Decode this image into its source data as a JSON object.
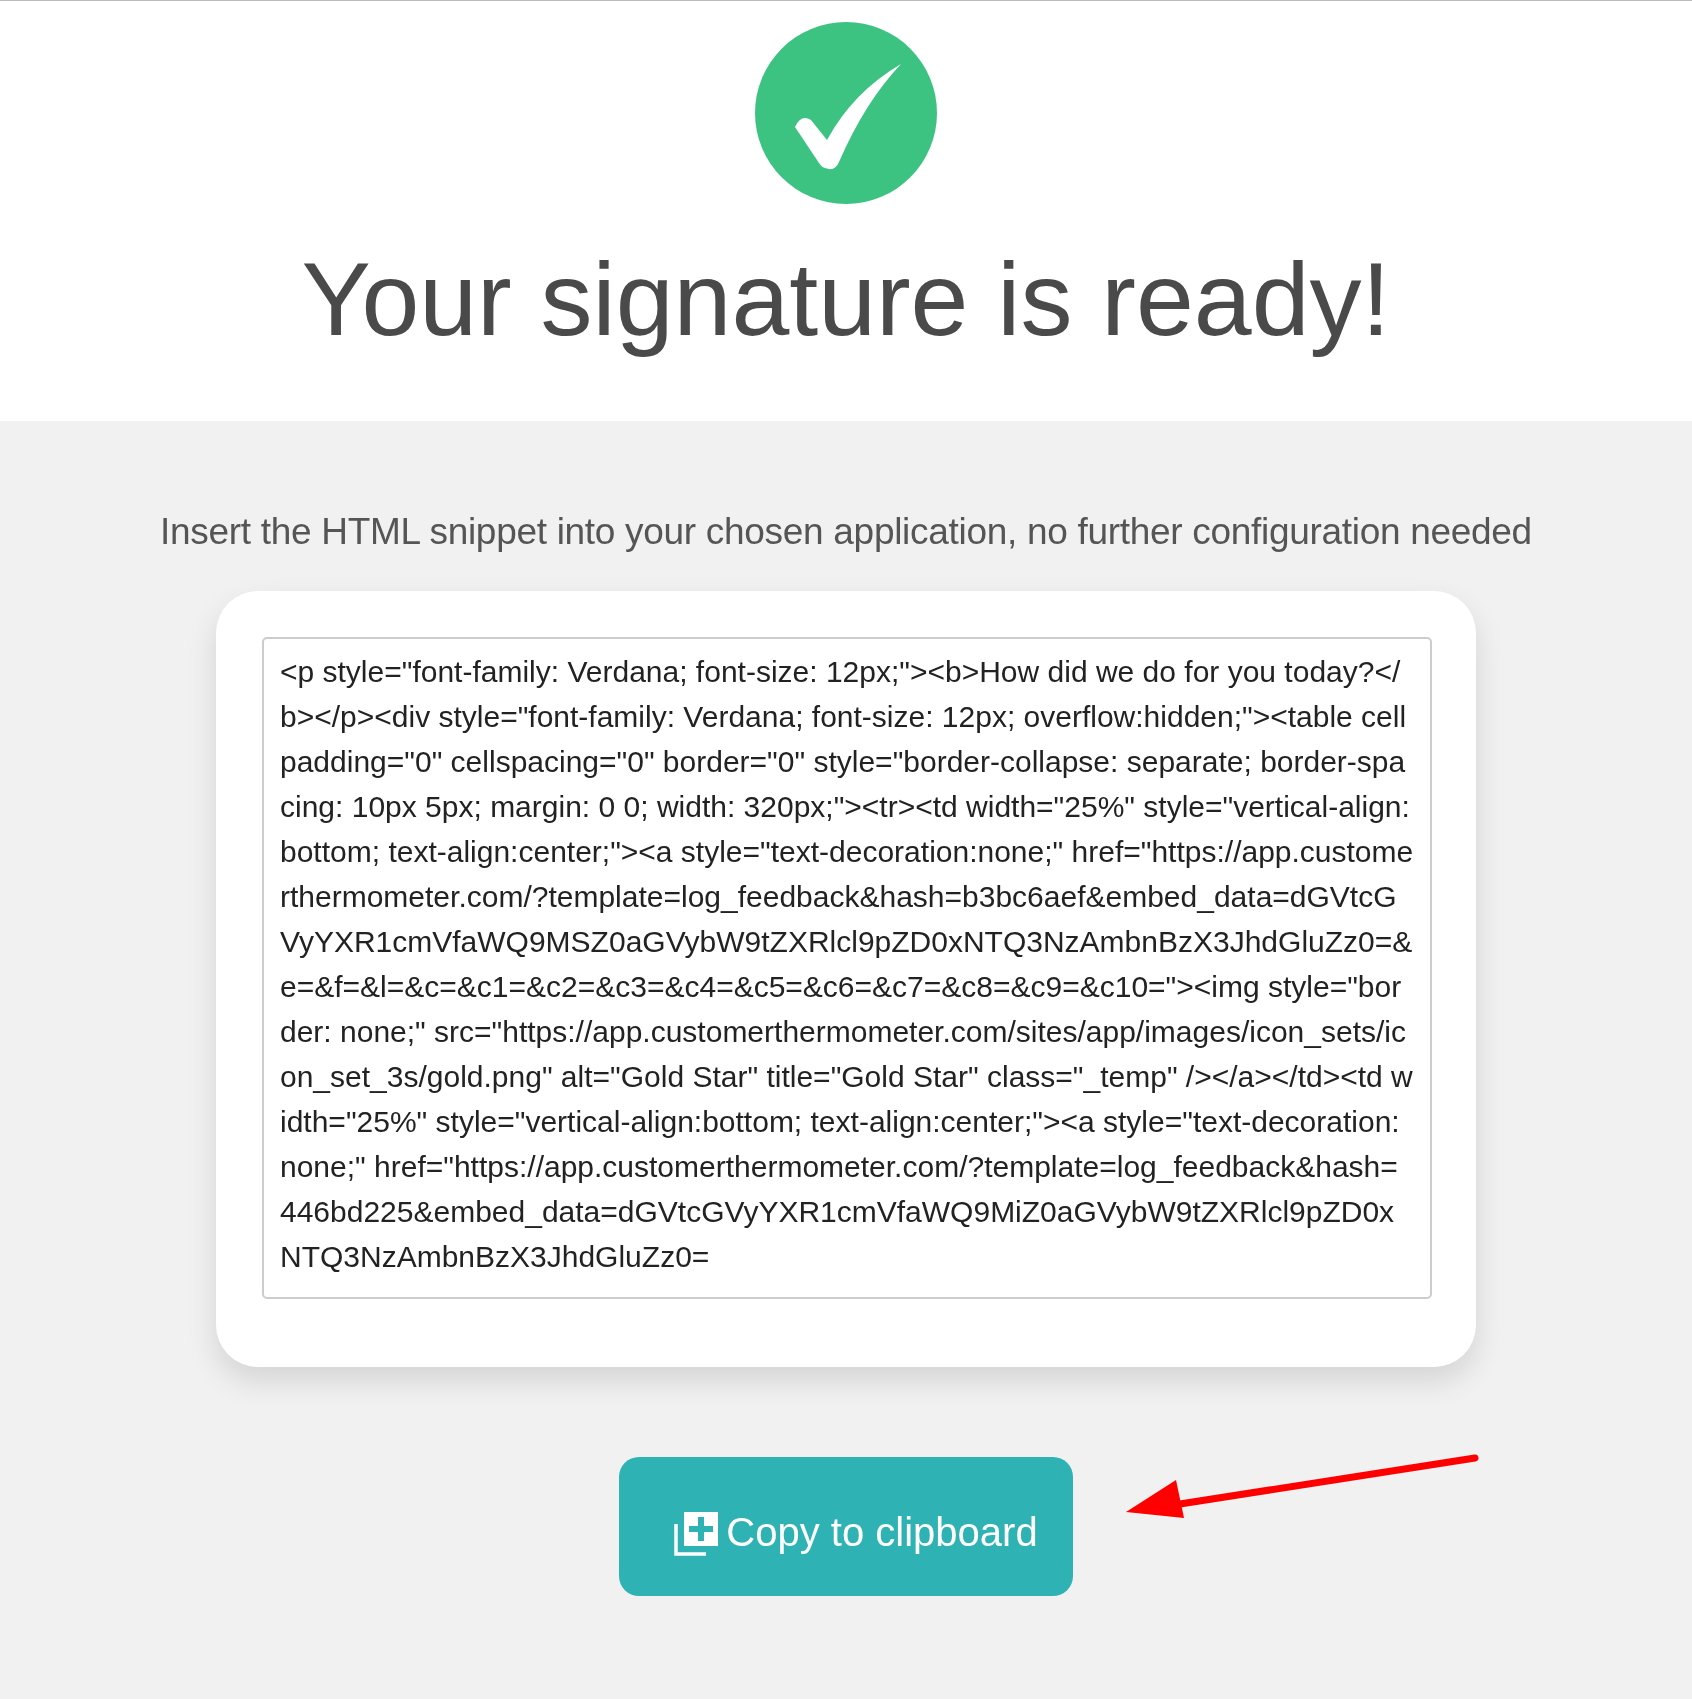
{
  "header": {
    "title": "Your signature is ready!"
  },
  "instructions": "Insert the HTML snippet into your chosen application, no further configuration needed",
  "snippet": {
    "value": "<p style=\"font-family: Verdana; font-size: 12px;\"><b>How did we do for you today?</b></p><div style=\"font-family: Verdana; font-size: 12px; overflow:hidden;\"><table cellpadding=\"0\" cellspacing=\"0\" border=\"0\" style=\"border-collapse: separate; border-spacing: 10px 5px; margin: 0 0; width: 320px;\"><tr><td width=\"25%\" style=\"vertical-align:bottom; text-align:center;\"><a style=\"text-decoration:none;\" href=\"https://app.customerthermometer.com/?template=log_feedback&hash=b3bc6aef&embed_data=dGVtcGVyYXR1cmVfaWQ9MSZ0aGVybW9tZXRlcl9pZD0xNTQ3NzAmbnBzX3JhdGluZz0=&e=&f=&l=&c=&c1=&c2=&c3=&c4=&c5=&c6=&c7=&c8=&c9=&c10=\"><img style=\"border: none;\" src=\"https://app.customerthermometer.com/sites/app/images/icon_sets/icon_set_3s/gold.png\" alt=\"Gold Star\" title=\"Gold Star\" class=\"_temp\" /></a></td><td width=\"25%\" style=\"vertical-align:bottom; text-align:center;\"><a style=\"text-decoration:none;\" href=\"https://app.customerthermometer.com/?template=log_feedback&hash=446bd225&embed_data=dGVtcGVyYXR1cmVfaWQ9MiZ0aGVybW9tZXRlcl9pZD0xNTQ3NzAmbnBzX3JhdGluZz0="
  },
  "copy_button": {
    "label": "Copy to clipboard"
  }
}
